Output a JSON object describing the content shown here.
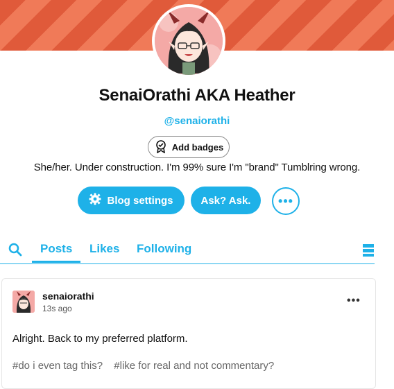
{
  "blog": {
    "title": "SenaiOrathi AKA Heather",
    "handle": "@senaiorathi",
    "bio": "She/her. Under construction. I'm 99% sure I'm \"brand\" Tumblring wrong.",
    "add_badges_label": "Add badges"
  },
  "actions": {
    "settings_label": "Blog settings",
    "ask_label": "Ask? Ask.",
    "more_icon": "ellipsis-icon"
  },
  "tabs": [
    {
      "label": "Posts",
      "active": true
    },
    {
      "label": "Likes",
      "active": false
    },
    {
      "label": "Following",
      "active": false
    }
  ],
  "post": {
    "username": "senaiorathi",
    "time": "13s ago",
    "body": "Alright. Back to my preferred platform.",
    "tags": [
      "#do i even tag this?",
      "#like for real and not commentary?"
    ]
  },
  "colors": {
    "accent": "#1eb1e8",
    "banner": "#e05a3a"
  }
}
